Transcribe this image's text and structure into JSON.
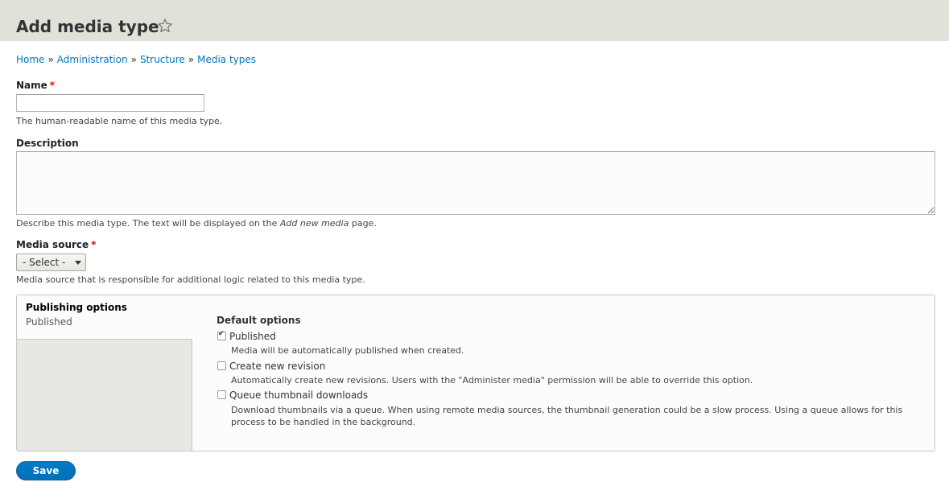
{
  "header": {
    "title": "Add media type",
    "star_icon": "star-outline-icon"
  },
  "breadcrumb": {
    "items": [
      "Home",
      "Administration",
      "Structure",
      "Media types"
    ],
    "separator": "»"
  },
  "form": {
    "name": {
      "label": "Name",
      "required_mark": "*",
      "value": "",
      "description": "The human-readable name of this media type."
    },
    "description": {
      "label": "Description",
      "value": "",
      "description_before": "Describe this media type. The text will be displayed on the ",
      "description_em": "Add new media",
      "description_after": " page."
    },
    "media_source": {
      "label": "Media source",
      "required_mark": "*",
      "selected": "- Select -",
      "description": "Media source that is responsible for additional logic related to this media type."
    },
    "publishing": {
      "tab_title": "Publishing options",
      "tab_summary": "Published",
      "legend": "Default options",
      "options": [
        {
          "label": "Published",
          "checked": true,
          "description": "Media will be automatically published when created."
        },
        {
          "label": "Create new revision",
          "checked": false,
          "description": "Automatically create new revisions. Users with the \"Administer media\" permission will be able to override this option."
        },
        {
          "label": "Queue thumbnail downloads",
          "checked": false,
          "description": "Download thumbnails via a queue. When using remote media sources, the thumbnail generation could be a slow process. Using a queue allows for this process to be handled in the background."
        }
      ]
    },
    "save_label": "Save"
  },
  "colors": {
    "header_bg": "#e1e0d9",
    "link": "#0074bd",
    "required": "#ee0000",
    "primary_button": "#0071b8"
  }
}
